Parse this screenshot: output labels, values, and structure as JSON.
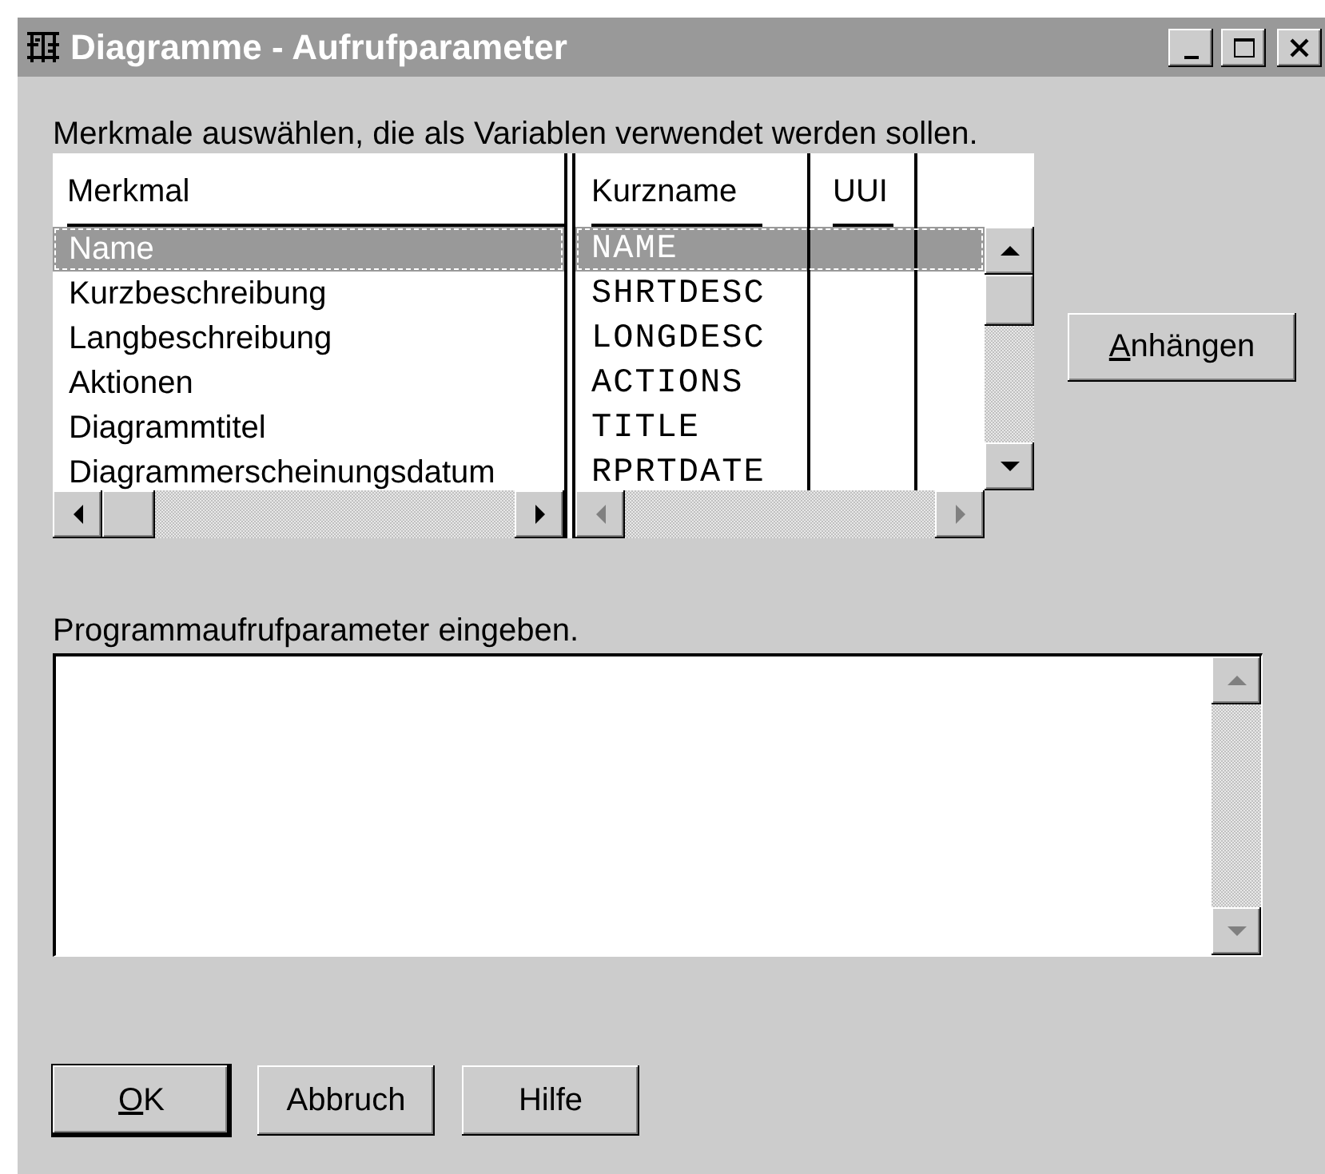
{
  "window": {
    "title": "Diagramme - Aufrufparameter"
  },
  "attributes": {
    "label": "Merkmale auswählen, die als Variablen verwendet werden sollen.",
    "columns": [
      "Merkmal",
      "Kurzname",
      "UUI"
    ],
    "rows": [
      {
        "merkmal": "Name",
        "kurzname": "NAME",
        "selected": true
      },
      {
        "merkmal": "Kurzbeschreibung",
        "kurzname": "SHRTDESC",
        "selected": false
      },
      {
        "merkmal": "Langbeschreibung",
        "kurzname": "LONGDESC",
        "selected": false
      },
      {
        "merkmal": "Aktionen",
        "kurzname": "ACTIONS",
        "selected": false
      },
      {
        "merkmal": "Diagrammtitel",
        "kurzname": "TITLE",
        "selected": false
      },
      {
        "merkmal": "Diagrammerscheinungsdatum",
        "kurzname": "RPRTDATE",
        "selected": false
      }
    ]
  },
  "append_button": {
    "label": "Anhängen",
    "mnemonic": true
  },
  "parameters": {
    "label": "Programmaufrufparameter eingeben."
  },
  "buttons": [
    {
      "label": "OK",
      "mnemonic": true,
      "default": true
    },
    {
      "label": "Abbruch",
      "mnemonic": false,
      "default": false
    },
    {
      "label": "Hilfe",
      "mnemonic": false,
      "default": false
    }
  ]
}
